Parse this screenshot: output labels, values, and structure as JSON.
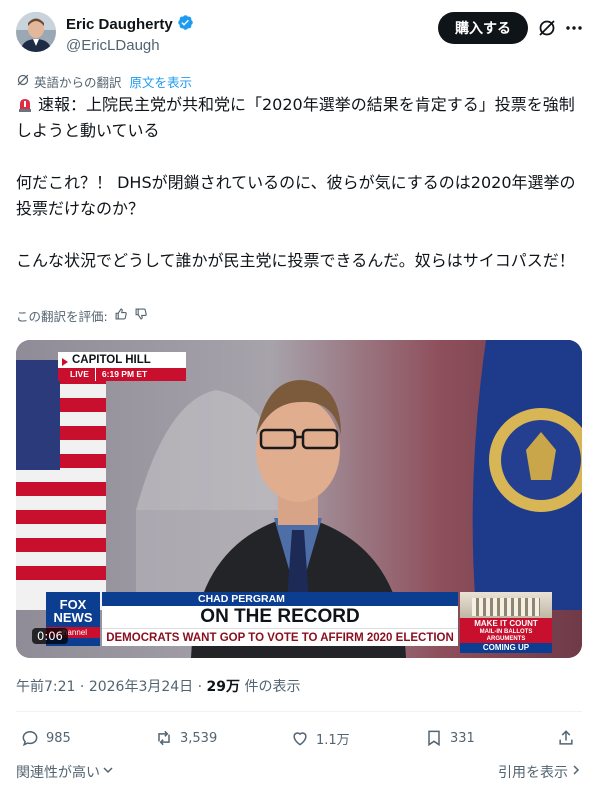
{
  "author": {
    "display_name": "Eric Daugherty",
    "handle": "@EricLDaugh",
    "verified": true
  },
  "header": {
    "buy_label": "購入する",
    "grok_icon": "grok-icon",
    "more_icon": "more-icon"
  },
  "translation": {
    "label": "英語からの翻訳",
    "show_original": "原文を表示",
    "rate_label": "この翻訳を評価:"
  },
  "tweet": {
    "line1": "速報：上院民主党が共和党に「2020年選挙の結果を肯定する」投票を強制しようと動いている",
    "line2": "何だこれ？！ DHSが閉鎖されているのに、彼らが気にするのは2020年選挙の投票だけなのか？",
    "line3": "こんな状況でどうして誰かが民主党に投票できるんだ。奴らはサイコパスだ！"
  },
  "video": {
    "location": "CAPITOL HILL",
    "live_label": "LIVE",
    "live_time": "6:19 PM ET",
    "network": "FOX NEWS",
    "network_suffix": "channel",
    "speaker_name": "CHAD PERGRAM",
    "headline": "ON THE RECORD",
    "subheadline": "DEMOCRATS WANT GOP TO VOTE TO AFFIRM 2020 ELECTION",
    "side_line1": "MAKE IT COUNT",
    "side_line2": "MAIL-IN BALLOTS ARGUMENTS",
    "side_line3": "COMING UP",
    "duration": "0:06"
  },
  "meta": {
    "time": "午前7:21",
    "date": "2026年3月24日",
    "views": "29万",
    "views_suffix": "件の表示"
  },
  "actions": {
    "replies": "985",
    "reposts": "3,539",
    "likes": "1.1万",
    "bookmarks": "331"
  },
  "footer": {
    "relevance": "関連性が高い",
    "quotes": "引用を表示"
  },
  "colors": {
    "accent": "#1d9bf0",
    "text": "#0f1419",
    "muted": "#536471",
    "fox_blue": "#0b3d91",
    "fox_red": "#c8102e"
  }
}
